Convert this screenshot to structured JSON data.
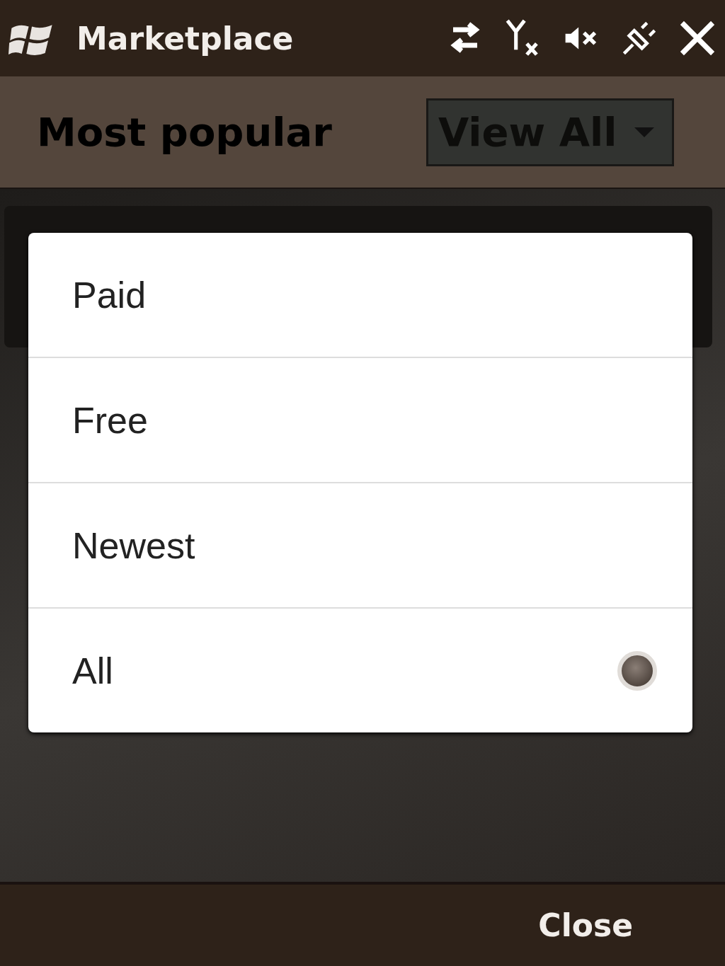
{
  "title_bar": {
    "title": "Marketplace"
  },
  "header": {
    "title": "Most popular",
    "dropdown": {
      "value": "View All"
    }
  },
  "menu": {
    "items": [
      {
        "label": "Paid",
        "selected": false
      },
      {
        "label": "Free",
        "selected": false
      },
      {
        "label": "Newest",
        "selected": false
      },
      {
        "label": "All",
        "selected": true
      }
    ]
  },
  "soft_keys": {
    "right": "Close"
  }
}
